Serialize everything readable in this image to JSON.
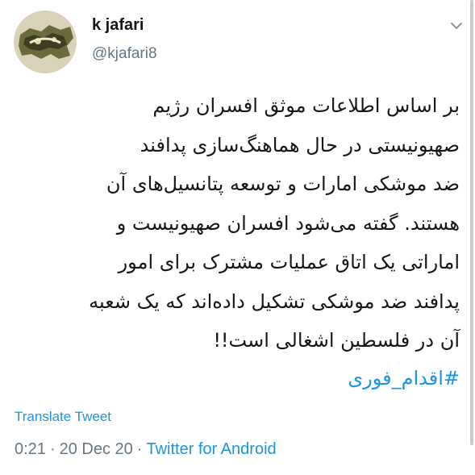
{
  "user": {
    "display_name": "k jafari",
    "handle": "@kjafari8"
  },
  "tweet": {
    "lines": [
      "بر اساس اطلاعات موثق افسران رژیم",
      "صهیونیستی در حال هماهنگ‌سازی پدافند",
      "ضد موشکی امارات و توسعه پتانسیل‌های آن",
      "هستند. گفته می‌شود افسران صهیونیست و",
      "اماراتی یک اتاق عملیات مشترک برای امور",
      "پدافند ضد موشکی تشکیل داده‌اند که یک شعبه",
      "آن در فلسطین اشغالی است!!"
    ],
    "hashtag": "#اقدام_فوری",
    "translate_label": "Translate Tweet",
    "time": "0:21",
    "date": "20 Dec 20",
    "separator": "·",
    "source": "Twitter for Android"
  },
  "icons": {
    "avatar": "profile-avatar",
    "caret": "chevron-down-icon"
  },
  "colors": {
    "link": "#1b95e0",
    "secondary": "#657786",
    "text": "#14171a"
  }
}
